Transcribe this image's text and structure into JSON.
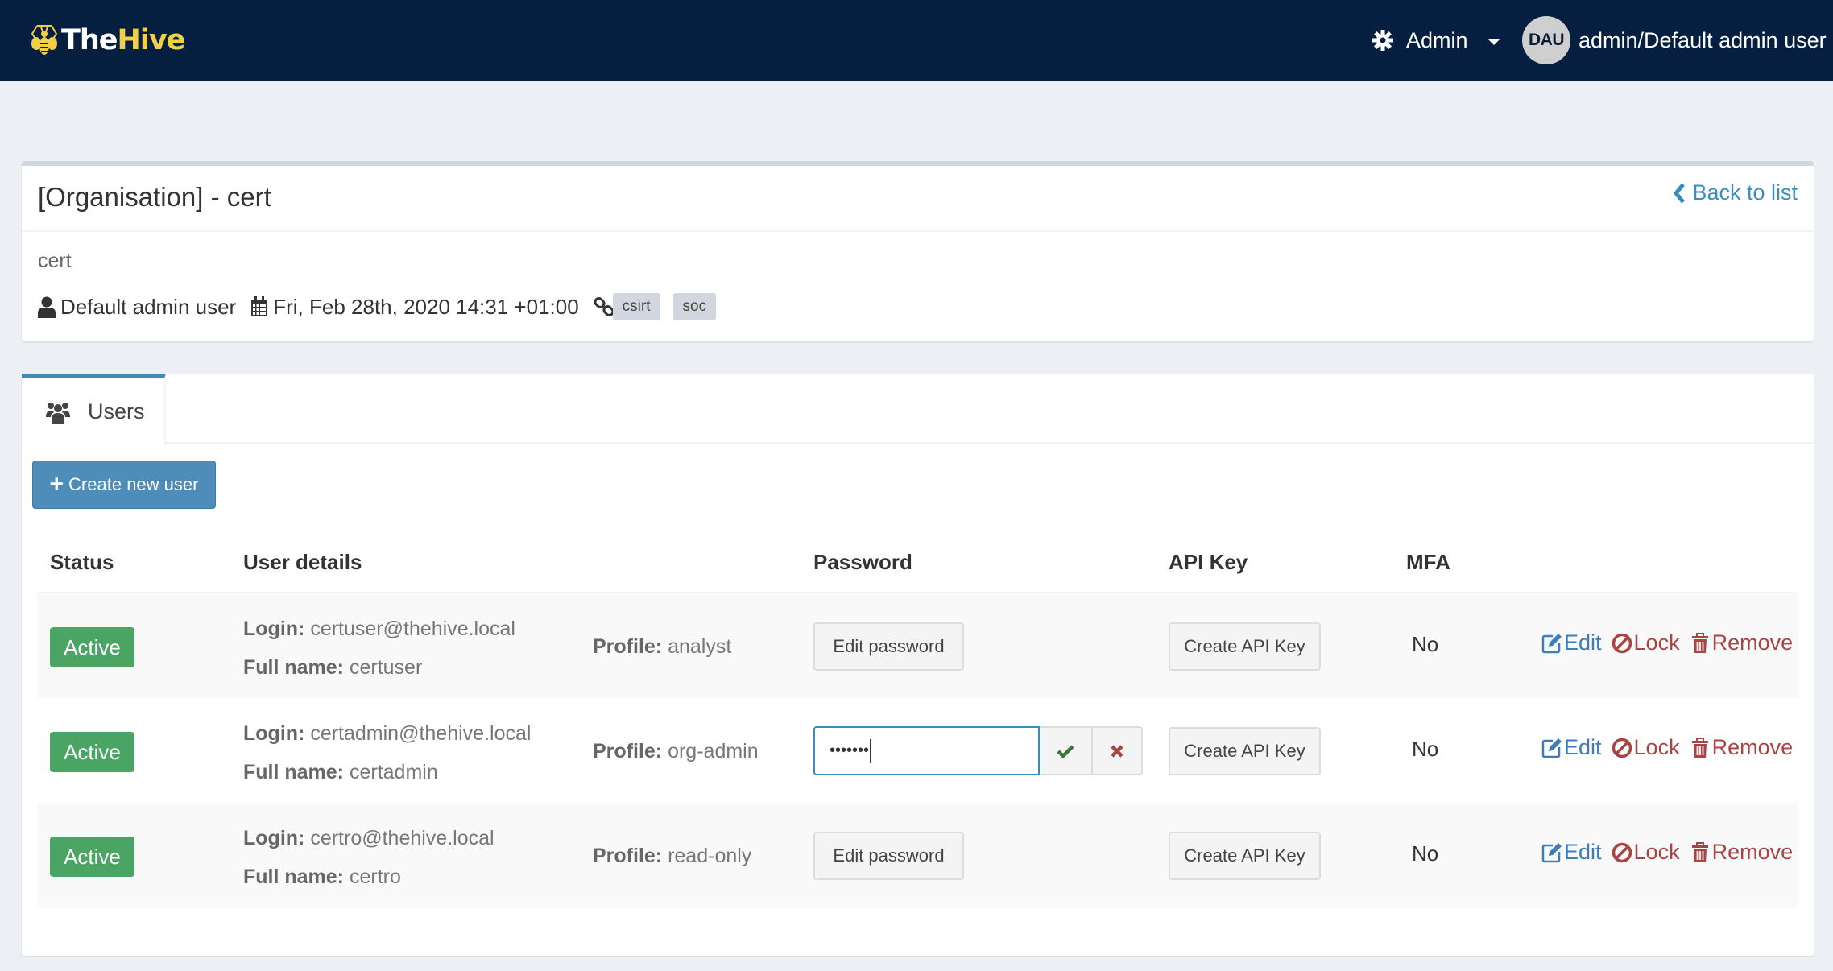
{
  "navbar": {
    "brand_part1": "The",
    "brand_part2": "Hive",
    "admin_menu_label": "Admin",
    "user_initials": "DAU",
    "user_label": "admin/Default admin user"
  },
  "organisation": {
    "title": "[Organisation] - cert",
    "back_link": "Back to list",
    "description": "cert",
    "created_by": "Default admin user",
    "created_at": "Fri, Feb 28th, 2020 14:31 +01:00",
    "linked_tags": [
      "csirt",
      "soc"
    ]
  },
  "tabs": [
    {
      "label": "Users",
      "icon": "users-icon",
      "active": true
    }
  ],
  "create_user_button": "Create new user",
  "users_table": {
    "columns": {
      "status": "Status",
      "user_details": "User details",
      "password": "Password",
      "api_key": "API Key",
      "mfa": "MFA"
    },
    "labels": {
      "login": "Login:",
      "full_name": "Full name:",
      "profile": "Profile:",
      "edit_password": "Edit password",
      "create_api_key": "Create API Key",
      "edit": "Edit",
      "lock": "Lock",
      "remove": "Remove"
    },
    "rows": [
      {
        "status": "Active",
        "login": "certuser@thehive.local",
        "full_name": "certuser",
        "profile": "analyst",
        "password_editing": false,
        "mfa": "No"
      },
      {
        "status": "Active",
        "login": "certadmin@thehive.local",
        "full_name": "certadmin",
        "profile": "org-admin",
        "password_editing": true,
        "password_value": "•••••••",
        "mfa": "No"
      },
      {
        "status": "Active",
        "login": "certro@thehive.local",
        "full_name": "certro",
        "profile": "read-only",
        "password_editing": false,
        "mfa": "No"
      }
    ]
  },
  "colors": {
    "navbar_bg": "#061f40",
    "brand_accent": "#f1cf46",
    "primary": "#3c8dbc",
    "success": "#4aa564",
    "danger": "#a94442"
  }
}
